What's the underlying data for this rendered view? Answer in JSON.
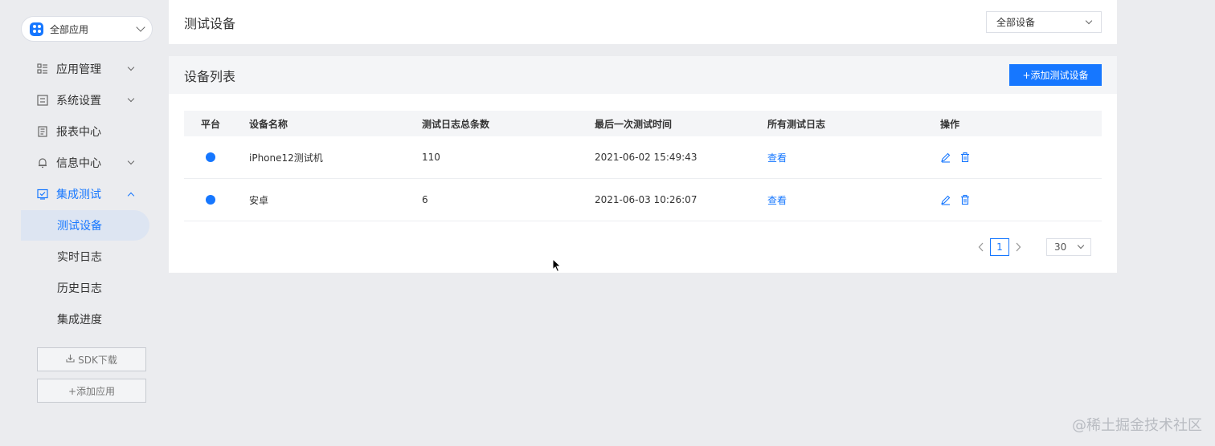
{
  "app_select": {
    "label": "全部应用",
    "icon": "app-grid-icon"
  },
  "menu": [
    {
      "label": "应用管理",
      "icon": "app-manage-icon",
      "expandable": true
    },
    {
      "label": "系统设置",
      "icon": "settings-icon",
      "expandable": true
    },
    {
      "label": "报表中心",
      "icon": "report-icon",
      "expandable": false
    },
    {
      "label": "信息中心",
      "icon": "bell-icon",
      "expandable": true
    },
    {
      "label": "集成测试",
      "icon": "integration-test-icon",
      "expandable": true,
      "expanded": true
    }
  ],
  "submenu": [
    "测试设备",
    "实时日志",
    "历史日志",
    "集成进度"
  ],
  "sidebar_buttons": {
    "sdk": "SDK下载",
    "add_app": "+添加应用"
  },
  "header": {
    "title": "测试设备",
    "device_filter": "全部设备"
  },
  "list": {
    "title": "设备列表",
    "add_button": "+添加测试设备",
    "columns": [
      "平台",
      "设备名称",
      "测试日志总条数",
      "最后一次测试时间",
      "所有测试日志",
      "操作"
    ],
    "rows": [
      {
        "name": "iPhone12测试机",
        "count": "110",
        "last_time": "2021-06-02 15:49:43",
        "logs": "查看"
      },
      {
        "name": "安卓",
        "count": "6",
        "last_time": "2021-06-03 10:26:07",
        "logs": "查看"
      }
    ]
  },
  "pagination": {
    "current": "1",
    "page_size": "30"
  },
  "watermark": "@稀土掘金技术社区",
  "colors": {
    "accent": "#1677ff",
    "background": "#ebecef",
    "selected_bg": "#dde5f2"
  }
}
